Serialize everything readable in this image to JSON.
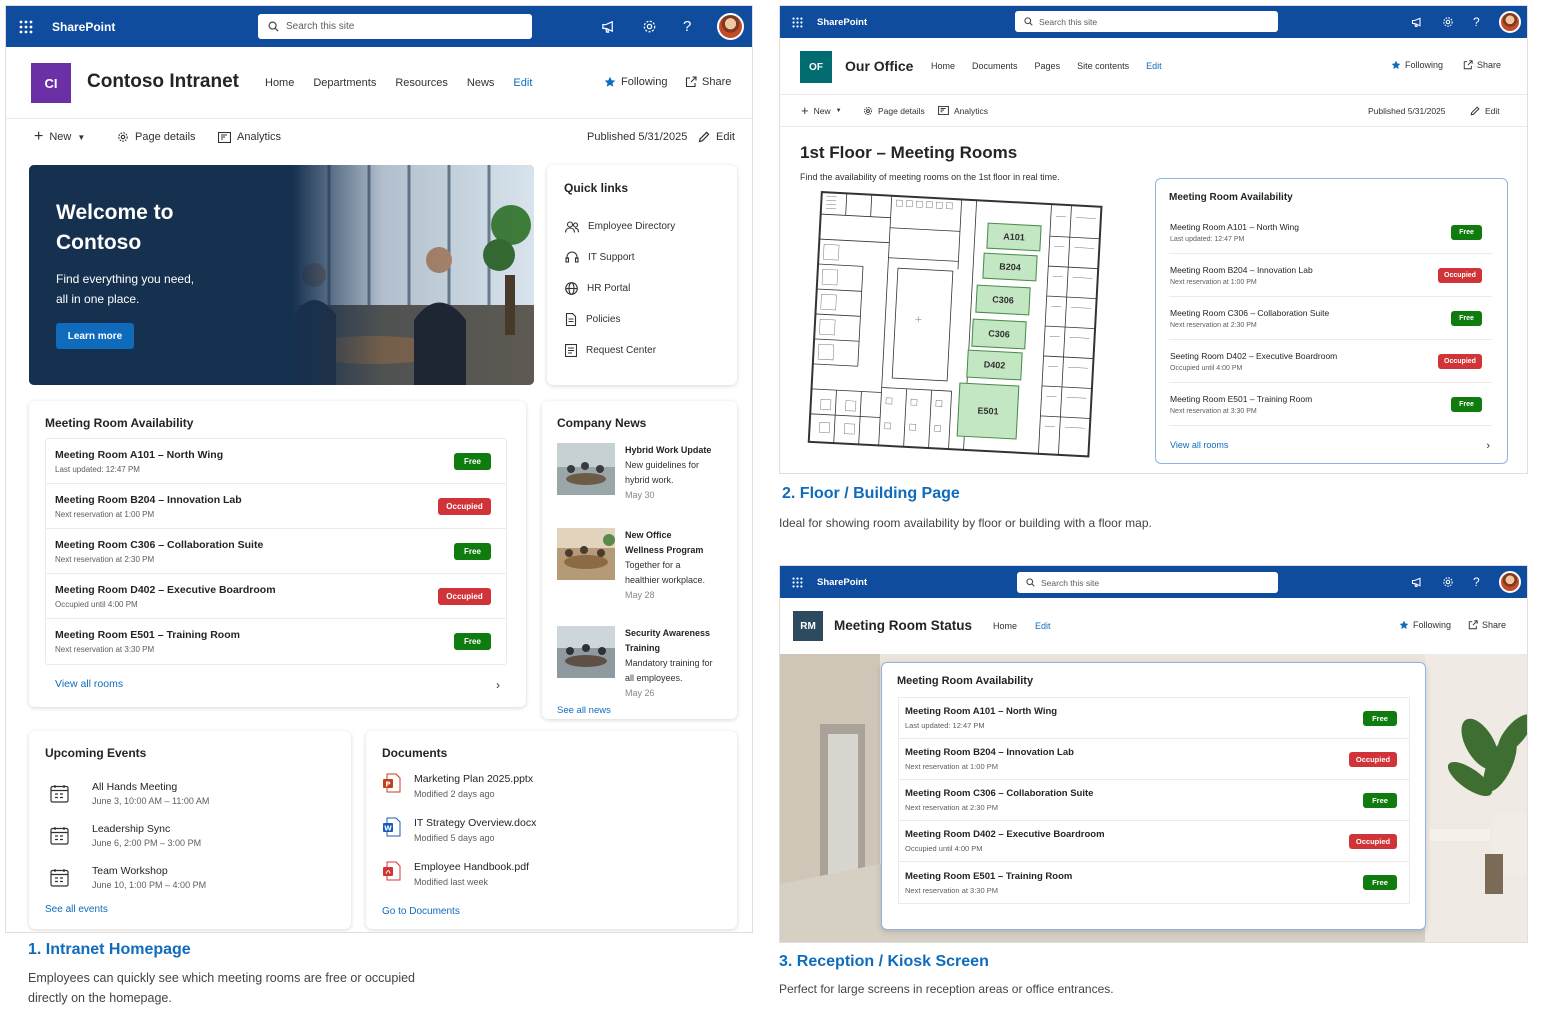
{
  "suite": {
    "brand": "SharePoint",
    "search_placeholder": "Search this site"
  },
  "status_colors": {
    "free": "#107c10",
    "occupied": "#d13438",
    "accent": "#0f6cbd",
    "suite_bar": "#0f4c9e"
  },
  "rooms": [
    {
      "name": "Meeting Room A101 – North Wing",
      "sub": "Last updated: 12:47 PM",
      "status": "Free",
      "state": "free"
    },
    {
      "name": "Meeting Room B204 – Innovation Lab",
      "sub": "Next reservation at 1:00 PM",
      "status": "Occupied",
      "state": "occupied"
    },
    {
      "name": "Meeting Room C306 – Collaboration Suite",
      "sub": "Next reservation at 2:30 PM",
      "status": "Free",
      "state": "free"
    },
    {
      "name": "Meeting Room D402 – Executive Boardroom",
      "sub": "Occupied until 4:00 PM",
      "status": "Occupied",
      "state": "occupied"
    },
    {
      "name": "Meeting Room E501 – Training Room",
      "sub": "Next reservation at 3:30 PM",
      "status": "Free",
      "state": "free"
    }
  ],
  "p1": {
    "logo": "CI",
    "site_title": "Contoso Intranet",
    "nav": [
      "Home",
      "Departments",
      "Resources",
      "News",
      "Edit"
    ],
    "following": "Following",
    "share": "Share",
    "cmd": {
      "new": "New",
      "page_details": "Page details",
      "analytics": "Analytics",
      "published": "Published 5/31/2025",
      "edit": "Edit"
    },
    "hero": {
      "title_line1": "Welcome to",
      "title_line2": "Contoso",
      "text_line1": "Find everything you need,",
      "text_line2": "all in one place.",
      "button": "Learn more"
    },
    "quick_links": {
      "title": "Quick links",
      "items": [
        "Employee Directory",
        "IT Support",
        "HR Portal",
        "Policies",
        "Request Center"
      ]
    },
    "availability": {
      "title": "Meeting Room Availability",
      "view_all": "View all rooms"
    },
    "news": {
      "title": "Company News",
      "items": [
        {
          "title": "Hybrid Work Update",
          "body": [
            "New guidelines for",
            "hybrid work."
          ],
          "date": "May 30"
        },
        {
          "title_lines": [
            "New Office",
            "Wellness Program"
          ],
          "body": [
            "Together for a",
            "healthier workplace."
          ],
          "date": "May 28"
        },
        {
          "title_lines": [
            "Security Awareness",
            "Training"
          ],
          "body": [
            "Mandatory training for",
            "all employees."
          ],
          "date": "May 26"
        }
      ],
      "see_all": "See all news"
    },
    "events": {
      "title": "Upcoming Events",
      "items": [
        {
          "title": "All Hands Meeting",
          "time": "June 3, 10:00 AM – 11:00 AM"
        },
        {
          "title": "Leadership Sync",
          "time": "June 6, 2:00 PM – 3:00 PM"
        },
        {
          "title": "Team Workshop",
          "time": "June 10, 1:00 PM – 4:00 PM"
        }
      ],
      "see_all": "See all events"
    },
    "documents": {
      "title": "Documents",
      "items": [
        {
          "name": "Marketing Plan 2025.pptx",
          "meta": "Modified 2 days ago",
          "type": "pptx",
          "color": "#c43e1c"
        },
        {
          "name": "IT Strategy Overview.docx",
          "meta": "Modified 5 days ago",
          "type": "docx",
          "color": "#185abd"
        },
        {
          "name": "Employee Handbook.pdf",
          "meta": "Modified last week",
          "type": "pdf",
          "color": "#d13438"
        }
      ],
      "go_to": "Go to Documents"
    },
    "caption_title": "1. Intranet Homepage",
    "caption_desc_line1": "Employees can quickly see which meeting rooms are free or occupied",
    "caption_desc_line2": "directly on the homepage."
  },
  "p2": {
    "logo": "OF",
    "site_title": "Our Office",
    "nav": [
      "Home",
      "Documents",
      "Pages",
      "Site contents",
      "Edit"
    ],
    "following": "Following",
    "share": "Share",
    "cmd": {
      "new": "New",
      "page_details": "Page details",
      "analytics": "Analytics",
      "published": "Published 5/31/2025",
      "edit": "Edit"
    },
    "page_title": "1st Floor – Meeting Rooms",
    "page_desc": "Find the availability of meeting rooms on the 1st floor in real time.",
    "map_rooms": [
      "A101",
      "B204",
      "C306",
      "C306",
      "D402",
      "E501"
    ],
    "availability": {
      "title": "Meeting Room Availability",
      "view_all": "View all rooms"
    },
    "room_names": [
      "Meeting Room A101 – North Wing",
      "Meeting Room B204 – Innovation Lab",
      "Meeting Room C306 – Collaboration Suite",
      "Seeting Room D402 – Executive Boardroom",
      "Meeting Room E501 – Training Room"
    ],
    "caption_title": "2. Floor / Building Page",
    "caption_desc": "Ideal for showing room availability by floor or building with a floor map."
  },
  "p3": {
    "logo": "RM",
    "site_title": "Meeting Room Status",
    "nav": [
      "Home",
      "Edit"
    ],
    "following": "Following",
    "share": "Share",
    "availability": {
      "title": "Meeting Room Availability"
    },
    "caption_title": "3. Reception / Kiosk Screen",
    "caption_desc": "Perfect for large screens in reception areas or office entrances."
  }
}
